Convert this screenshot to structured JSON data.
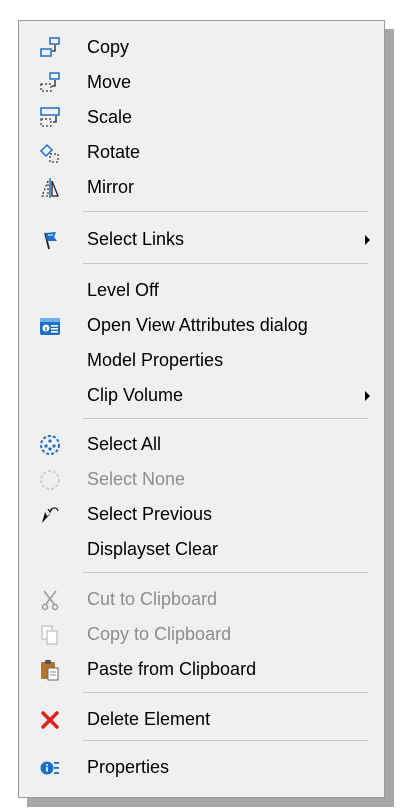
{
  "menu": {
    "items": [
      {
        "label": "Copy",
        "icon": "copy-element-icon",
        "disabled": false
      },
      {
        "label": "Move",
        "icon": "move-element-icon",
        "disabled": false
      },
      {
        "label": "Scale",
        "icon": "scale-element-icon",
        "disabled": false
      },
      {
        "label": "Rotate",
        "icon": "rotate-element-icon",
        "disabled": false
      },
      {
        "label": "Mirror",
        "icon": "mirror-element-icon",
        "disabled": false
      },
      {
        "label": "Select Links",
        "icon": "select-links-flag-icon",
        "disabled": false,
        "submenu": true
      },
      {
        "label": "Level Off",
        "disabled": false
      },
      {
        "label": "Open View Attributes dialog",
        "icon": "view-attributes-icon",
        "disabled": false
      },
      {
        "label": "Model Properties",
        "disabled": false
      },
      {
        "label": "Clip Volume",
        "disabled": false,
        "submenu": true
      },
      {
        "label": "Select All",
        "icon": "select-all-icon",
        "disabled": false
      },
      {
        "label": "Select None",
        "icon": "select-none-icon",
        "disabled": true
      },
      {
        "label": "Select Previous",
        "icon": "select-previous-icon",
        "disabled": false
      },
      {
        "label": "Displayset Clear",
        "disabled": false
      },
      {
        "label": "Cut to Clipboard",
        "icon": "scissors-icon",
        "disabled": true
      },
      {
        "label": "Copy to Clipboard",
        "icon": "clipboard-copy-icon",
        "disabled": true
      },
      {
        "label": "Paste from Clipboard",
        "icon": "clipboard-paste-icon",
        "disabled": false
      },
      {
        "label": "Delete Element",
        "icon": "delete-x-icon",
        "disabled": false
      },
      {
        "label": "Properties",
        "icon": "properties-info-icon",
        "disabled": false
      }
    ]
  },
  "colors": {
    "menu_background": "#f0f0f0",
    "disabled_text": "#8d8d8d",
    "icon_blue": "#1e6fc4",
    "delete_red": "#e0201b"
  }
}
